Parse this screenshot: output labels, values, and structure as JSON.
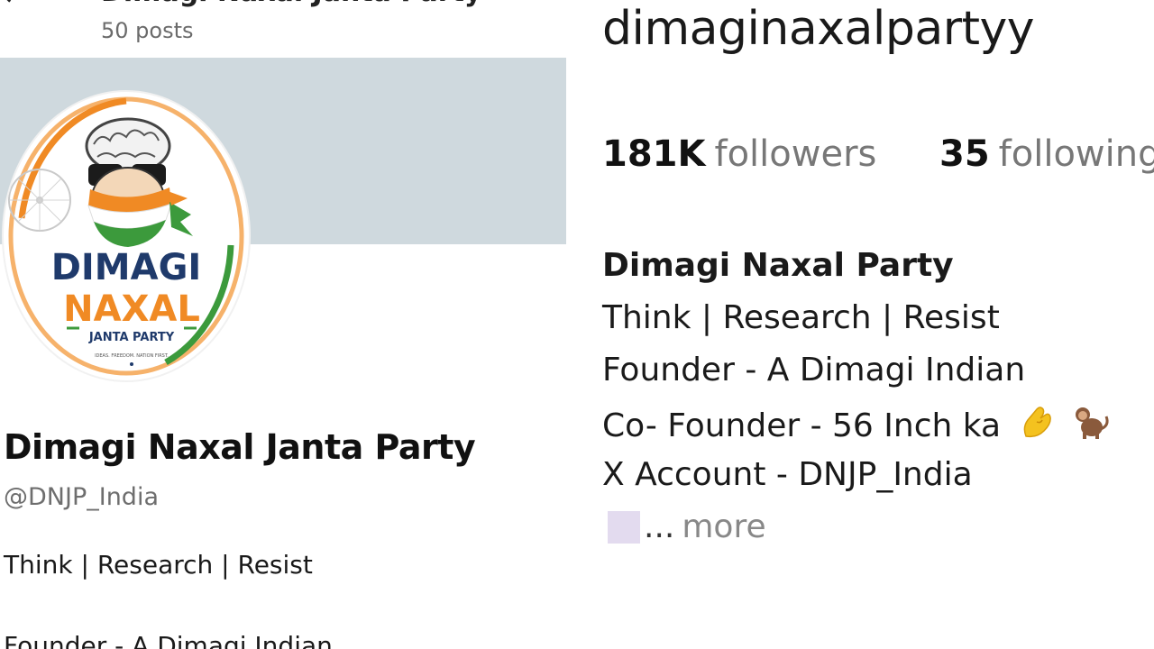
{
  "x_profile": {
    "back_icon": "arrow-left-icon",
    "header_title": "Dimagi Naxal Janta Party",
    "posts_count": "50 posts",
    "banner_color": "#cfd9de",
    "avatar": {
      "line1": "DIMAGI",
      "line2": "NAXAL",
      "line3": "JANTA PARTY",
      "tagline": "IDEAS. FREEDOM. NATION FIRST.",
      "colors": {
        "saffron": "#f08a24",
        "green": "#3c9a3c",
        "navy": "#1f3a6b"
      }
    },
    "display_name": "Dimagi Naxal Janta Party",
    "handle": "@DNJP_India",
    "bio_line1": "Think | Research | Resist",
    "bio_line2": "Founder - A Dimagi Indian"
  },
  "ig_profile": {
    "username": "dimaginaxalpartyy",
    "followers_count": "181K",
    "followers_label": "followers",
    "following_count": "35",
    "following_label": "following",
    "name": "Dimagi Naxal Party",
    "bio": [
      "Think | Research | Resist",
      "Founder - A Dimagi Indian",
      "Co- Founder - 56 Inch ka",
      "X Account - DNJP_India"
    ],
    "bio_emojis": [
      "pinching-hand-icon",
      "monkey-icon"
    ],
    "ellipsis": "...",
    "more_label": "more"
  }
}
